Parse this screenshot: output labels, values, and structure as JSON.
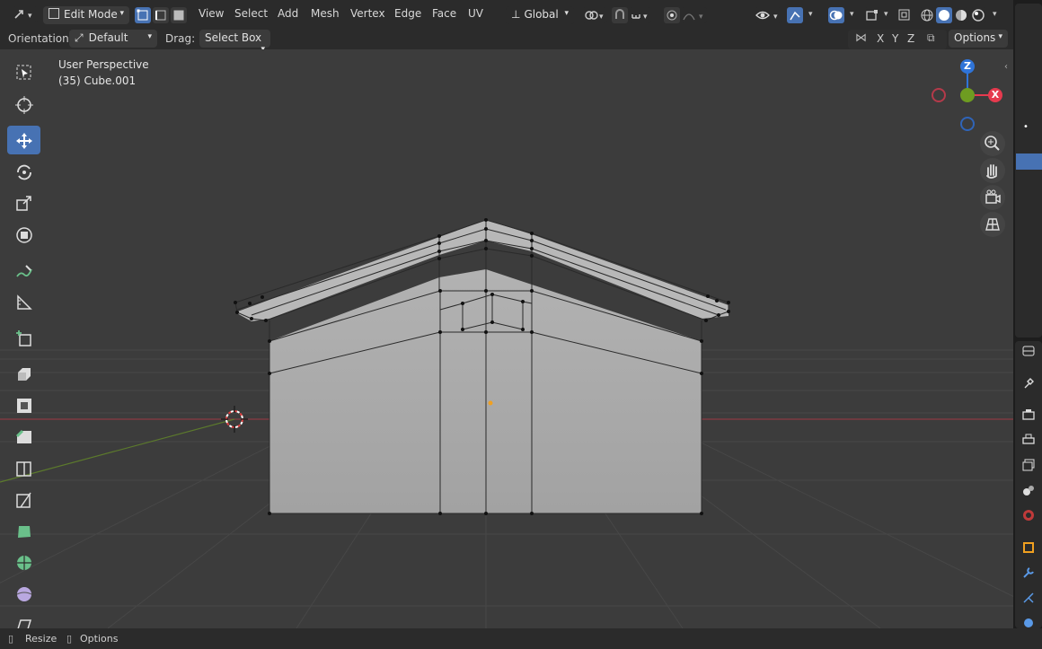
{
  "header": {
    "mode": "Edit Mode",
    "menus": [
      "View",
      "Select",
      "Add",
      "Mesh",
      "Vertex",
      "Edge",
      "Face",
      "UV"
    ],
    "transform_orientation": "Global"
  },
  "tool_settings": {
    "orientation_label": "Orientation:",
    "orientation_value": "Default",
    "drag_label": "Drag:",
    "drag_value": "Select Box",
    "axes": [
      "X",
      "Y",
      "Z"
    ],
    "options_label": "Options"
  },
  "viewport": {
    "perspective_label": "User Perspective",
    "object_label": "(35) Cube.001"
  },
  "nav_gizmo": {
    "z": "Z",
    "x": "X"
  },
  "statusbar": {
    "resize": "Resize",
    "options": "Options"
  },
  "colors": {
    "accent": "#4772b3",
    "x_axis": "#e63a4e",
    "y_axis": "#6e9c21",
    "z_axis": "#2f74d8",
    "mesh": "#a9a9a9"
  },
  "icons": [
    "select-box-icon",
    "cursor-icon",
    "move-icon",
    "rotate-icon",
    "scale-icon",
    "transform-icon",
    "annotate-icon",
    "measure-icon",
    "add-cube-icon",
    "extrude-icon",
    "inset-icon",
    "bevel-icon",
    "loop-cut-icon",
    "knife-icon",
    "poly-build-icon",
    "spin-icon",
    "smooth-icon",
    "shear-icon"
  ]
}
